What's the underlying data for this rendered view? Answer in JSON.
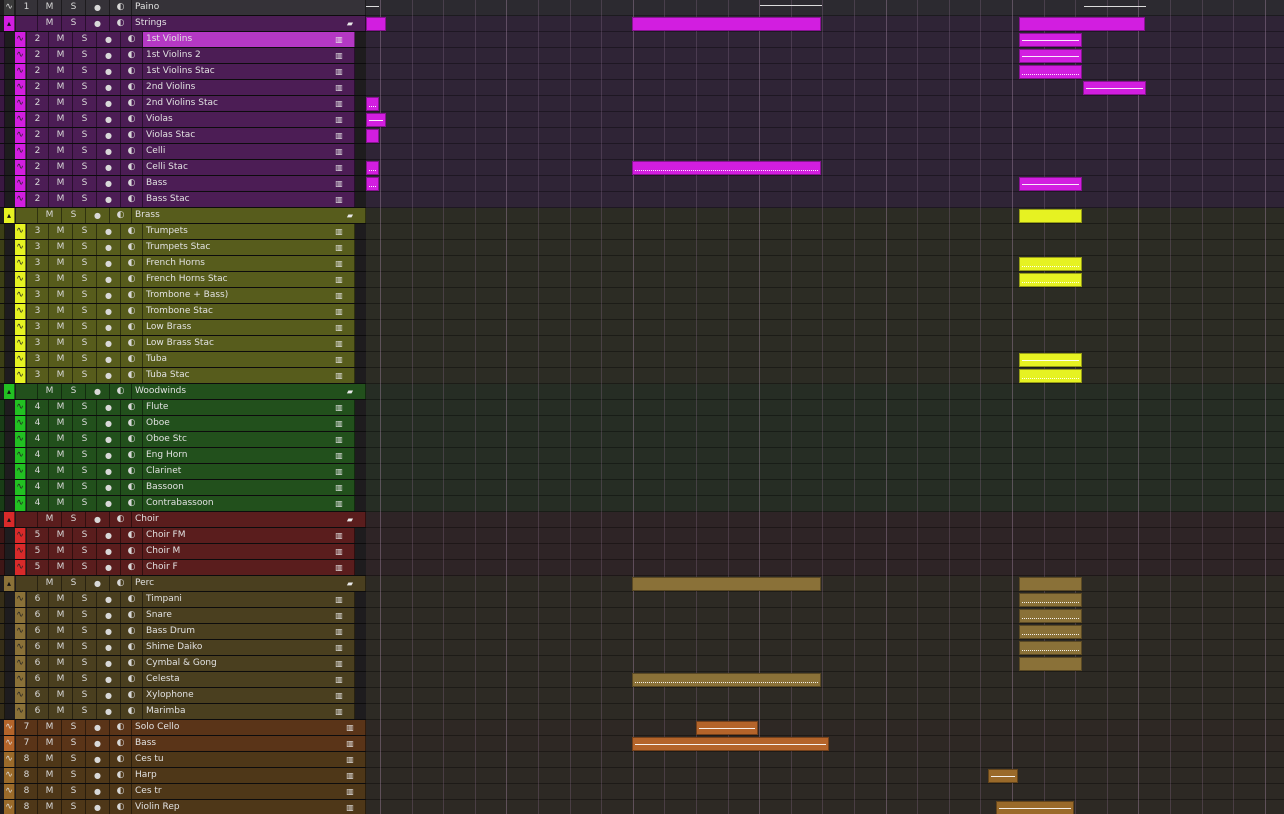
{
  "colors": {
    "strings": "#d21ee0",
    "brass": "#e6f222",
    "woodwinds": "#22c022",
    "choir": "#d82a2a",
    "perc": "#8a7138",
    "solo": "#b4642a",
    "extra": "#9a6a2a"
  },
  "icons": {
    "automation": "automation-wave-icon",
    "collapse": "collapse-arrow-icon",
    "folder": "folder-icon",
    "instrument": "keyboard-icon",
    "record": "record-dot-icon",
    "monitor": "monitor-icon"
  },
  "labels": {
    "mute": "M",
    "solo": "S"
  },
  "tracks": [
    {
      "num": "1",
      "name": "Paino",
      "type": "header-track",
      "group": "piano"
    },
    {
      "num": "",
      "name": "Strings",
      "type": "folder",
      "group": "strings"
    },
    {
      "num": "2",
      "name": "1st Violins",
      "type": "inst",
      "group": "strings",
      "selected": true
    },
    {
      "num": "2",
      "name": "1st Violins 2",
      "type": "inst",
      "group": "strings"
    },
    {
      "num": "2",
      "name": "1st Violins  Stac",
      "type": "inst",
      "group": "strings"
    },
    {
      "num": "2",
      "name": "2nd Violins",
      "type": "inst",
      "group": "strings"
    },
    {
      "num": "2",
      "name": "2nd Violins  Stac",
      "type": "inst",
      "group": "strings"
    },
    {
      "num": "2",
      "name": "Violas",
      "type": "inst",
      "group": "strings"
    },
    {
      "num": "2",
      "name": "Violas Stac",
      "type": "inst",
      "group": "strings"
    },
    {
      "num": "2",
      "name": "Celli",
      "type": "inst",
      "group": "strings"
    },
    {
      "num": "2",
      "name": "Celli Stac",
      "type": "inst",
      "group": "strings"
    },
    {
      "num": "2",
      "name": "Bass",
      "type": "inst",
      "group": "strings"
    },
    {
      "num": "2",
      "name": "Bass Stac",
      "type": "inst",
      "group": "strings"
    },
    {
      "num": "",
      "name": "Brass",
      "type": "folder",
      "group": "brass"
    },
    {
      "num": "3",
      "name": "Trumpets",
      "type": "inst",
      "group": "brass"
    },
    {
      "num": "3",
      "name": "Trumpets Stac",
      "type": "inst",
      "group": "brass"
    },
    {
      "num": "3",
      "name": "French Horns",
      "type": "inst",
      "group": "brass"
    },
    {
      "num": "3",
      "name": "French Horns Stac",
      "type": "inst",
      "group": "brass"
    },
    {
      "num": "3",
      "name": "Trombone + Bass)",
      "type": "inst",
      "group": "brass"
    },
    {
      "num": "3",
      "name": "Trombone Stac",
      "type": "inst",
      "group": "brass"
    },
    {
      "num": "3",
      "name": "Low Brass",
      "type": "inst",
      "group": "brass"
    },
    {
      "num": "3",
      "name": "Low Brass Stac",
      "type": "inst",
      "group": "brass"
    },
    {
      "num": "3",
      "name": "Tuba",
      "type": "inst",
      "group": "brass"
    },
    {
      "num": "3",
      "name": "Tuba Stac",
      "type": "inst",
      "group": "brass"
    },
    {
      "num": "",
      "name": "Woodwinds",
      "type": "folder",
      "group": "woodwinds"
    },
    {
      "num": "4",
      "name": "Flute",
      "type": "inst",
      "group": "woodwinds"
    },
    {
      "num": "4",
      "name": "Oboe",
      "type": "inst",
      "group": "woodwinds"
    },
    {
      "num": "4",
      "name": "Oboe Stc",
      "type": "inst",
      "group": "woodwinds"
    },
    {
      "num": "4",
      "name": "Eng Horn",
      "type": "inst",
      "group": "woodwinds"
    },
    {
      "num": "4",
      "name": "Clarinet",
      "type": "inst",
      "group": "woodwinds"
    },
    {
      "num": "4",
      "name": "Bassoon",
      "type": "inst",
      "group": "woodwinds"
    },
    {
      "num": "4",
      "name": "Contrabassoon",
      "type": "inst",
      "group": "woodwinds"
    },
    {
      "num": "",
      "name": "Choir",
      "type": "folder",
      "group": "choir"
    },
    {
      "num": "5",
      "name": "Choir FM",
      "type": "inst",
      "group": "choir"
    },
    {
      "num": "5",
      "name": "Choir M",
      "type": "inst",
      "group": "choir"
    },
    {
      "num": "5",
      "name": "Choir F",
      "type": "inst",
      "group": "choir"
    },
    {
      "num": "",
      "name": "Perc",
      "type": "folder",
      "group": "perc"
    },
    {
      "num": "6",
      "name": "Timpani",
      "type": "inst",
      "group": "perc"
    },
    {
      "num": "6",
      "name": "Snare",
      "type": "inst",
      "group": "perc"
    },
    {
      "num": "6",
      "name": "Bass Drum",
      "type": "inst",
      "group": "perc"
    },
    {
      "num": "6",
      "name": "Shime Daiko",
      "type": "inst",
      "group": "perc"
    },
    {
      "num": "6",
      "name": "Cymbal & Gong",
      "type": "inst",
      "group": "perc"
    },
    {
      "num": "6",
      "name": "Celesta",
      "type": "inst",
      "group": "perc"
    },
    {
      "num": "6",
      "name": "Xylophone",
      "type": "inst",
      "group": "perc"
    },
    {
      "num": "6",
      "name": "Marimba",
      "type": "inst",
      "group": "perc"
    },
    {
      "num": "7",
      "name": "Solo Cello",
      "type": "top",
      "group": "solo"
    },
    {
      "num": "7",
      "name": "Bass",
      "type": "top",
      "group": "solo"
    },
    {
      "num": "8",
      "name": "Ces tu",
      "type": "top",
      "group": "extra"
    },
    {
      "num": "8",
      "name": "Harp",
      "type": "top",
      "group": "extra"
    },
    {
      "num": "8",
      "name": "Ces tr",
      "type": "top",
      "group": "extra"
    },
    {
      "num": "8",
      "name": "Violin Rep",
      "type": "top",
      "group": "extra"
    }
  ]
}
